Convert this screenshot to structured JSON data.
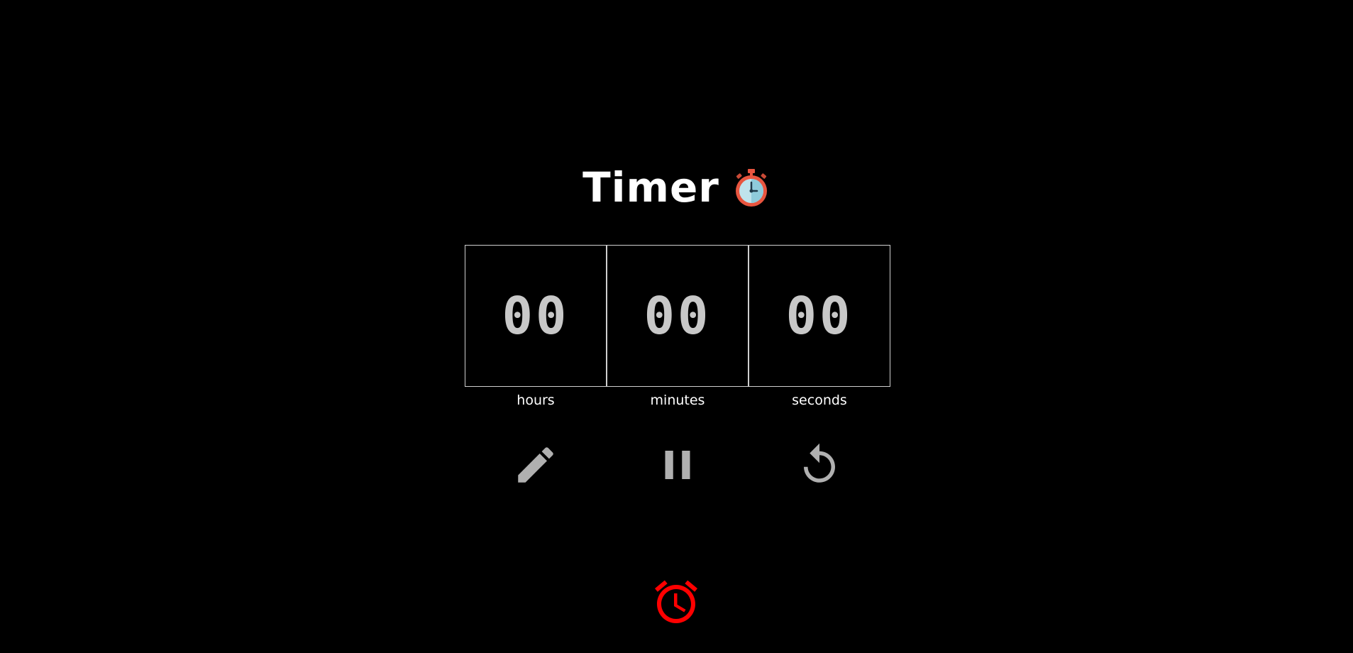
{
  "header": {
    "title": "Timer",
    "title_icon": "stopwatch-icon"
  },
  "timer": {
    "units": [
      {
        "value": "00",
        "label": "hours"
      },
      {
        "value": "00",
        "label": "minutes"
      },
      {
        "value": "00",
        "label": "seconds"
      }
    ]
  },
  "controls": {
    "edit_icon": "pencil-icon",
    "pause_icon": "pause-icon",
    "reset_icon": "reset-icon"
  },
  "alarm": {
    "icon": "alarm-clock-icon",
    "color": "#ff0000"
  },
  "colors": {
    "background": "#000000",
    "digits": "#c8c8c8",
    "icons": "#b0b0b0",
    "border": "#cfcfcf"
  }
}
